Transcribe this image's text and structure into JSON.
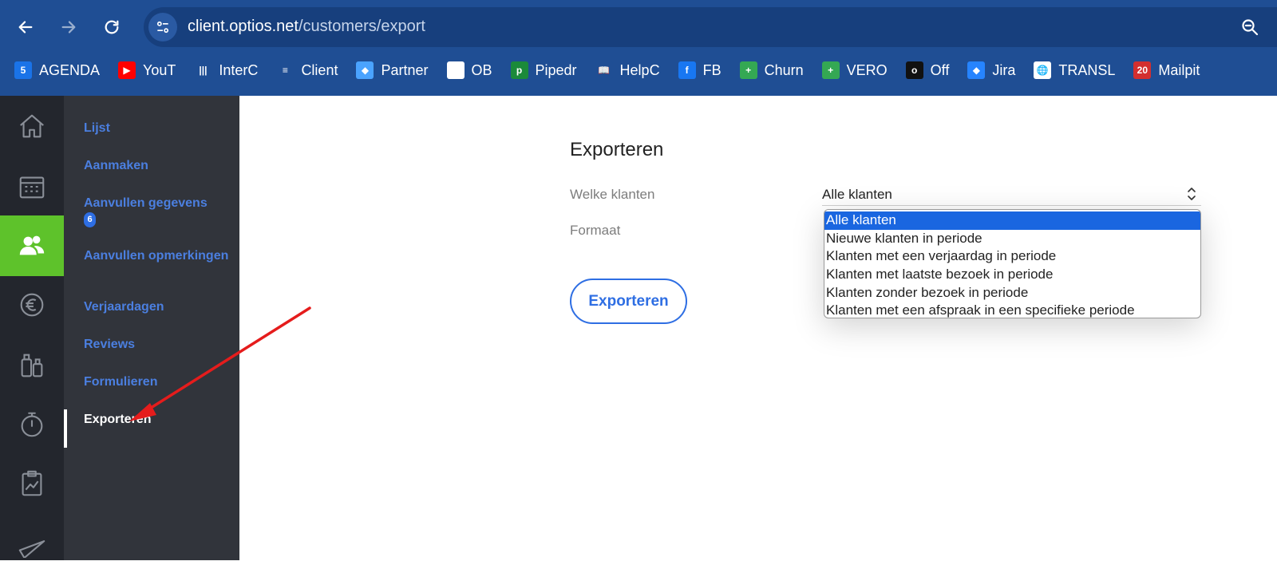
{
  "browser": {
    "url_host": "client.optios.net",
    "url_path": "/customers/export",
    "bookmarks": [
      {
        "label": "AGENDA",
        "icon": "calendar-icon",
        "color": "#1a73e8",
        "glyph": "5"
      },
      {
        "label": "YouT",
        "icon": "youtube-icon",
        "color": "#ff0000",
        "glyph": "▶"
      },
      {
        "label": "InterC",
        "icon": "intercom-icon",
        "color": "#1f4e94",
        "glyph": "|||"
      },
      {
        "label": "Client",
        "icon": "client-icon",
        "color": "#1f4e94",
        "glyph": "≡"
      },
      {
        "label": "Partner",
        "icon": "partner-icon",
        "color": "#4aa3ff",
        "glyph": "◆"
      },
      {
        "label": "OB",
        "icon": "blank-page-icon",
        "color": "#ffffff",
        "glyph": ""
      },
      {
        "label": "Pipedr",
        "icon": "pipedrive-icon",
        "color": "#1b8a3a",
        "glyph": "p"
      },
      {
        "label": "HelpC",
        "icon": "book-icon",
        "color": "#1f4e94",
        "glyph": "📖"
      },
      {
        "label": "FB",
        "icon": "facebook-icon",
        "color": "#1877f2",
        "glyph": "f"
      },
      {
        "label": "Churn",
        "icon": "sheets-icon",
        "color": "#34a853",
        "glyph": "+"
      },
      {
        "label": "VERO",
        "icon": "sheets-icon",
        "color": "#34a853",
        "glyph": "+"
      },
      {
        "label": "Off",
        "icon": "circle-icon",
        "color": "#111111",
        "glyph": "o"
      },
      {
        "label": "Jira",
        "icon": "jira-icon",
        "color": "#2684ff",
        "glyph": "◆"
      },
      {
        "label": "TRANSL",
        "icon": "globe-icon",
        "color": "#ffffff",
        "glyph": "🌐"
      },
      {
        "label": "Mailpit",
        "icon": "mailpit-icon",
        "color": "#d32f2f",
        "glyph": "20"
      }
    ]
  },
  "subnav": {
    "items": [
      {
        "label": "Lijst"
      },
      {
        "label": "Aanmaken"
      },
      {
        "label": "Aanvullen gegevens",
        "badge": "6"
      },
      {
        "label": "Aanvullen opmerkingen"
      },
      {
        "label": "Verjaardagen"
      },
      {
        "label": "Reviews"
      },
      {
        "label": "Formulieren"
      },
      {
        "label": "Exporteren"
      }
    ]
  },
  "main": {
    "title": "Exporteren",
    "which_label": "Welke klanten",
    "format_label": "Formaat",
    "selected_value": "Alle klanten",
    "export_button": "Exporteren",
    "options": [
      "Alle klanten",
      "Nieuwe klanten in periode",
      "Klanten met een verjaardag in periode",
      "Klanten met laatste bezoek in periode",
      "Klanten zonder bezoek in periode",
      "Klanten met een afspraak in een specifieke periode"
    ]
  },
  "colors": {
    "chrome": "#1f4e94",
    "accent_green": "#5ec22b",
    "link_blue": "#4b7fe0",
    "select_highlight": "#1a66e0",
    "annotation_arrow": "#e51c1c"
  }
}
